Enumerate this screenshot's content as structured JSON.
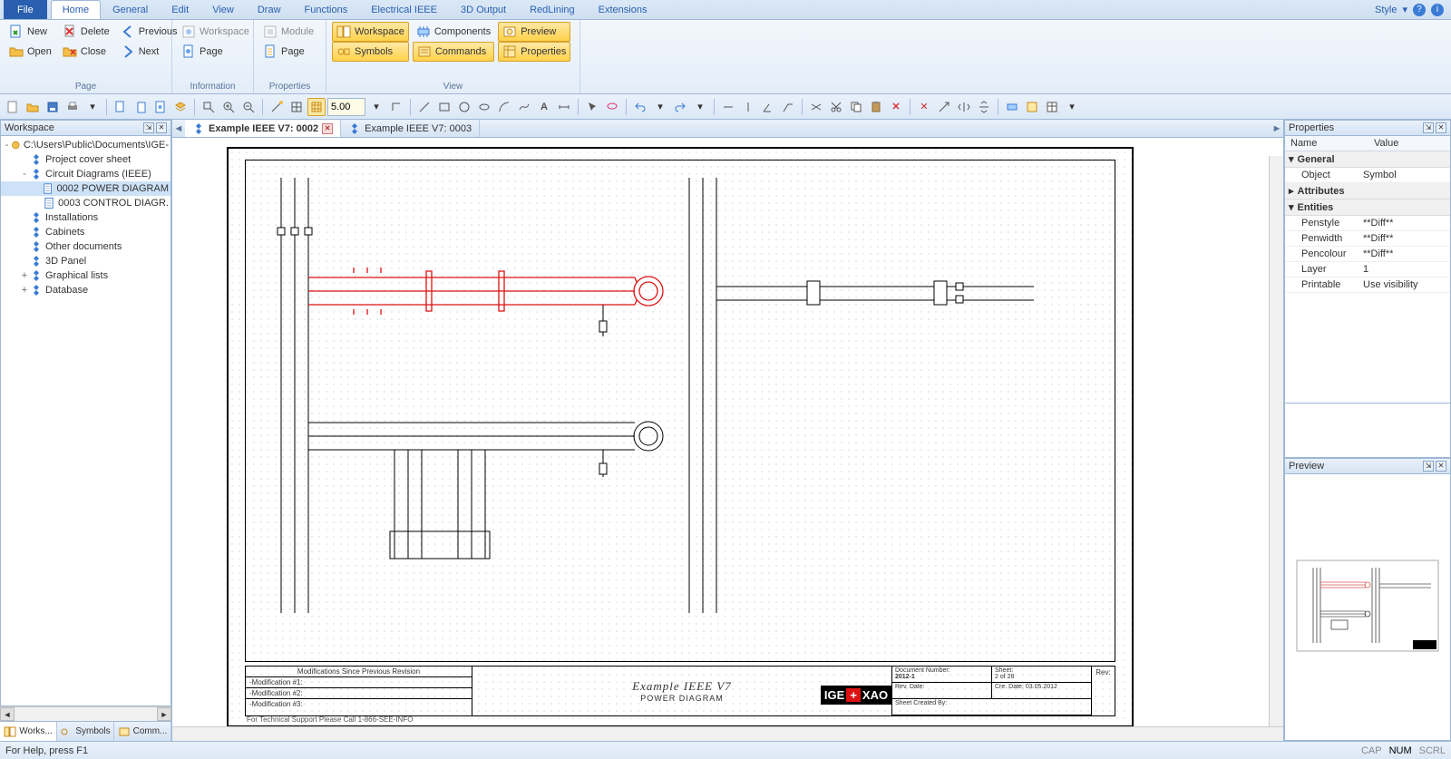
{
  "ribbon": {
    "tabs": [
      "File",
      "Home",
      "General",
      "Edit",
      "View",
      "Draw",
      "Functions",
      "Electrical IEEE",
      "3D Output",
      "RedLining",
      "Extensions"
    ],
    "active_index": 1,
    "style_label": "Style",
    "groups": {
      "page": {
        "label": "Page",
        "items": {
          "new": "New",
          "open": "Open",
          "delete": "Delete",
          "close": "Close",
          "previous": "Previous",
          "next": "Next"
        }
      },
      "information": {
        "label": "Information",
        "items": {
          "workspace": "Workspace",
          "page": "Page"
        }
      },
      "properties": {
        "label": "Properties",
        "items": {
          "module": "Module",
          "page": "Page"
        }
      },
      "view": {
        "label": "View",
        "items": {
          "workspace": "Workspace",
          "symbols": "Symbols",
          "components": "Components",
          "commands": "Commands",
          "preview": "Preview",
          "properties": "Properties"
        }
      }
    }
  },
  "qat": {
    "grid_value": "5.00"
  },
  "workspace_panel": {
    "title": "Workspace",
    "root": "C:\\Users\\Public\\Documents\\IGE-",
    "items": [
      {
        "label": "Project cover sheet",
        "icon": "blue-diamond",
        "indent": 1
      },
      {
        "label": "Circuit Diagrams (IEEE)",
        "icon": "blue-diamond",
        "indent": 1,
        "expander": "-"
      },
      {
        "label": "0002 POWER DIAGRAM",
        "icon": "page",
        "indent": 2,
        "selected": true
      },
      {
        "label": "0003 CONTROL DIAGR.",
        "icon": "page",
        "indent": 2
      },
      {
        "label": "Installations",
        "icon": "blue-diamond",
        "indent": 1
      },
      {
        "label": "Cabinets",
        "icon": "blue-diamond",
        "indent": 1
      },
      {
        "label": "Other documents",
        "icon": "blue-diamond",
        "indent": 1
      },
      {
        "label": "3D Panel",
        "icon": "blue-diamond",
        "indent": 1
      },
      {
        "label": "Graphical lists",
        "icon": "blue-diamond",
        "indent": 1,
        "expander": "+"
      },
      {
        "label": "Database",
        "icon": "blue-diamond",
        "indent": 1,
        "expander": "+"
      }
    ],
    "bottom_tabs": [
      "Works...",
      "Symbols",
      "Comm..."
    ],
    "bottom_active": 0
  },
  "doc_tabs": {
    "tabs": [
      {
        "label": "Example IEEE V7: 0002",
        "active": true,
        "closeable": true
      },
      {
        "label": "Example IEEE V7: 0003",
        "active": false,
        "closeable": false
      }
    ]
  },
  "drawing": {
    "title_main": "Example IEEE V7",
    "title_sub": "POWER DIAGRAM",
    "mods_header": "Modifications Since Previous Revision",
    "mod1": "-Modification #1:",
    "mod2": "-Modification #2:",
    "mod3": "-Modification #3:",
    "meta": {
      "doc_no_label": "Document Number:",
      "doc_no": "2012-1",
      "sheet_label": "Sheet:",
      "sheet": "2  of  28",
      "rev_date_label": "Rev. Date:",
      "cre_date_label": "Cre. Date:",
      "cre_date": "03.05.2012",
      "created_by_label": "Sheet Created By:",
      "rev_label": "Rev:"
    },
    "logo_left": "IGE",
    "logo_right": "XAO",
    "footnote": "For Technical Support Please Call 1-866-SEE-INFO"
  },
  "properties_panel": {
    "title": "Properties",
    "head_name": "Name",
    "head_value": "Value",
    "cats": {
      "general": {
        "label": "General",
        "rows": [
          {
            "k": "Object",
            "v": "Symbol"
          }
        ],
        "exp": "-"
      },
      "attributes": {
        "label": "Attributes",
        "rows": [],
        "exp": "+"
      },
      "entities": {
        "label": "Entities",
        "exp": "-",
        "rows": [
          {
            "k": "Penstyle",
            "v": "**Diff**"
          },
          {
            "k": "Penwidth",
            "v": "**Diff**"
          },
          {
            "k": "Pencolour",
            "v": "**Diff**"
          },
          {
            "k": "Layer",
            "v": "1"
          },
          {
            "k": "Printable",
            "v": "Use visibility"
          }
        ]
      }
    }
  },
  "preview_panel": {
    "title": "Preview"
  },
  "statusbar": {
    "help": "For Help, press F1",
    "indicators": {
      "cap": "CAP",
      "num": "NUM",
      "scrl": "SCRL"
    }
  }
}
